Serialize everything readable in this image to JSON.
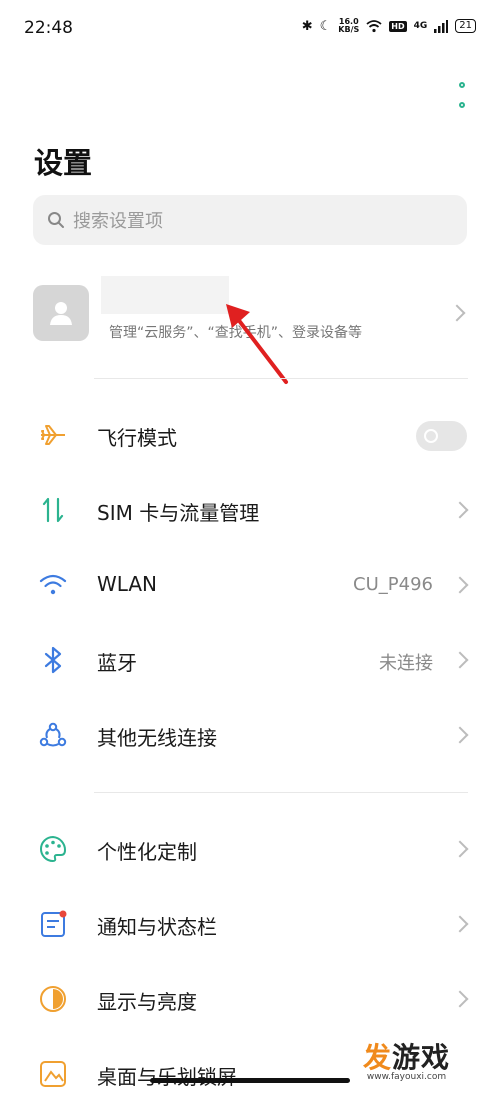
{
  "status_bar": {
    "time": "22:48",
    "net_speed_value": "16.0",
    "net_speed_unit": "KB/S",
    "hd_label": "HD",
    "network_label": "4G",
    "battery": "21"
  },
  "header": {
    "title": "设置"
  },
  "search": {
    "placeholder": "搜索设置项"
  },
  "account": {
    "subtitle": "管理“云服务”、“查找手机”、登录设备等"
  },
  "settings": {
    "airplane_mode": {
      "label": "飞行模式",
      "enabled": false
    },
    "sim": {
      "label": "SIM 卡与流量管理"
    },
    "wlan": {
      "label": "WLAN",
      "value": "CU_P496"
    },
    "bluetooth": {
      "label": "蓝牙",
      "value": "未连接"
    },
    "other_wireless": {
      "label": "其他无线连接"
    },
    "personalization": {
      "label": "个性化定制"
    },
    "notifications": {
      "label": "通知与状态栏"
    },
    "display": {
      "label": "显示与亮度"
    },
    "desktop": {
      "label": "桌面与乐划锁屏"
    }
  },
  "watermark": {
    "text_orange": "发",
    "text_dark": "游戏",
    "url": "www.fayouxi.com"
  },
  "colors": {
    "accent": "#2bb38f",
    "annotation_arrow": "#e02020",
    "watermark": "#f08a1c"
  }
}
